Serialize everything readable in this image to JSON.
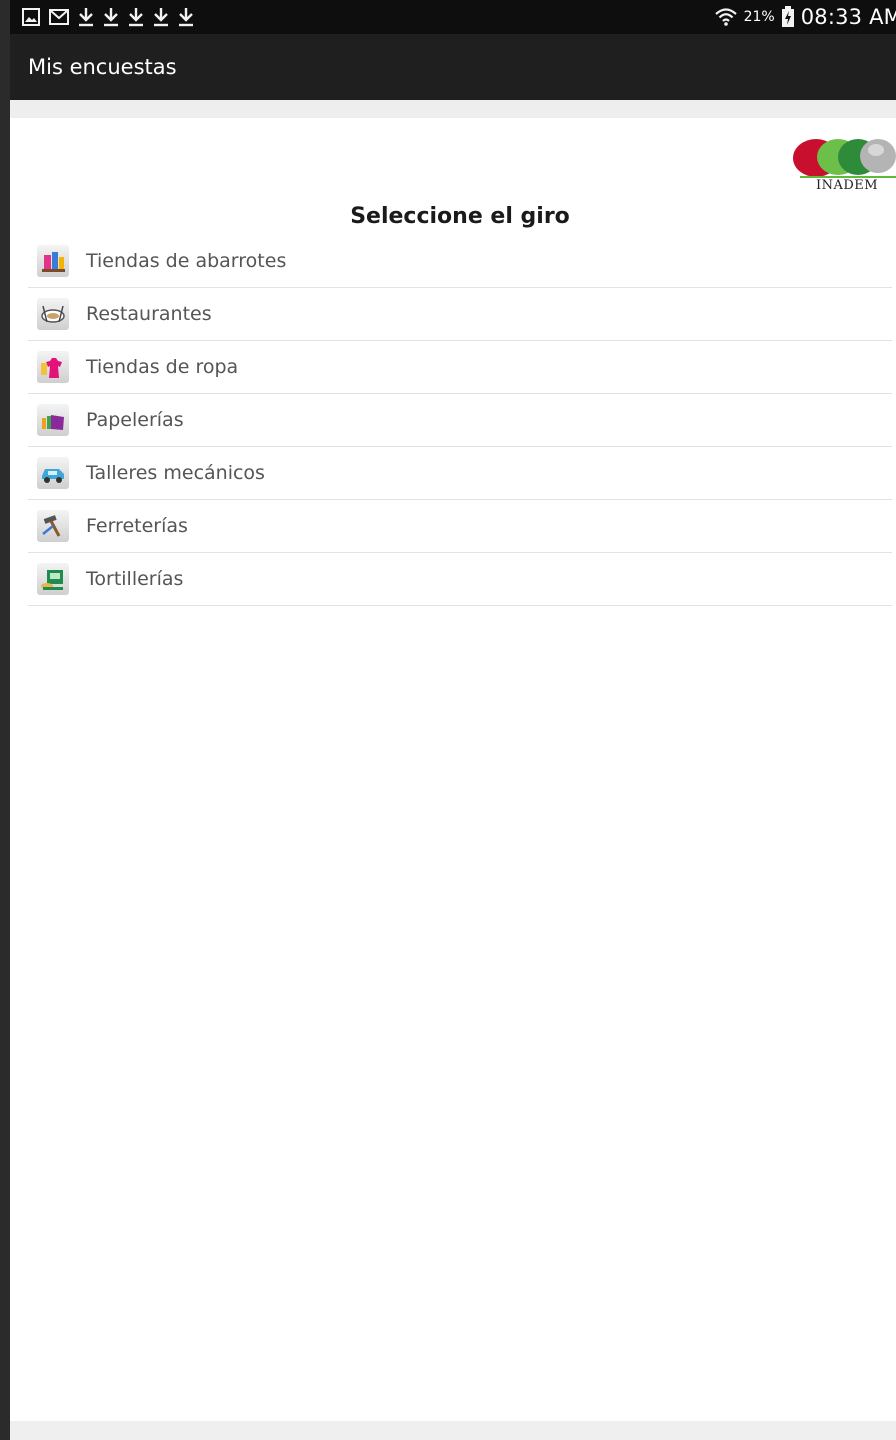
{
  "status_bar": {
    "icons_left": [
      "gallery-icon",
      "gmail-icon",
      "download-icon",
      "download-icon",
      "download-icon",
      "download-icon",
      "download-icon"
    ],
    "battery_percent": "21%",
    "time": "08:33 AM"
  },
  "action_bar": {
    "title": "Mis encuestas"
  },
  "logo": {
    "text": "INADEM",
    "colors": [
      "#c8102e",
      "#5fba3c",
      "#2e8b3a",
      "#a5a5a5"
    ]
  },
  "content": {
    "title": "Seleccione el giro",
    "items": [
      {
        "label": "Tiendas de abarrotes",
        "icon": "grocery-icon"
      },
      {
        "label": "Restaurantes",
        "icon": "restaurant-icon"
      },
      {
        "label": "Tiendas de ropa",
        "icon": "clothing-icon"
      },
      {
        "label": "Papelerías",
        "icon": "stationery-icon"
      },
      {
        "label": "Talleres mecánicos",
        "icon": "mechanic-icon"
      },
      {
        "label": "Ferreterías",
        "icon": "hardware-icon"
      },
      {
        "label": "Tortillerías",
        "icon": "tortilla-icon"
      }
    ]
  }
}
